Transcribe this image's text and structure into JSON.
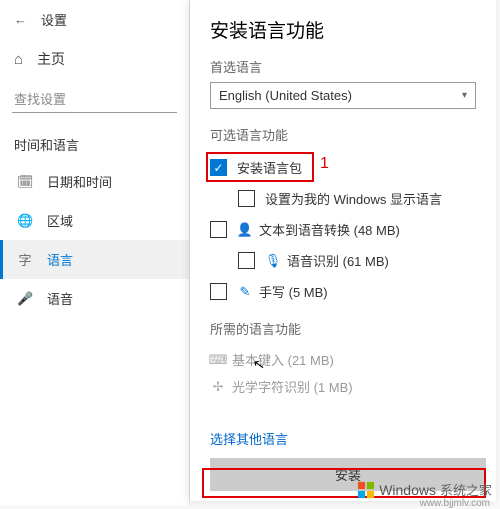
{
  "settings": {
    "title": "设置",
    "home": "主页",
    "search_placeholder": "查找设置",
    "section": "时间和语言",
    "nav": [
      {
        "icon": "calendar",
        "label": "日期和时间"
      },
      {
        "icon": "globe",
        "label": "区域"
      },
      {
        "icon": "lang",
        "label": "语言"
      },
      {
        "icon": "mic",
        "label": "语音"
      }
    ]
  },
  "panel": {
    "title": "安装语言功能",
    "preferred_label": "首选语言",
    "dropdown_value": "English (United States)",
    "optional_section": "可选语言功能",
    "options": [
      {
        "checked": true,
        "icon": "",
        "label": "安装语言包",
        "indent": false
      },
      {
        "checked": false,
        "icon": "",
        "label": "设置为我的 Windows 显示语言",
        "indent": true
      },
      {
        "checked": false,
        "icon": "tts",
        "label": "文本到语音转换 (48 MB)",
        "indent": false
      },
      {
        "checked": false,
        "icon": "speech",
        "label": "语音识别 (61 MB)",
        "indent": true
      },
      {
        "checked": false,
        "icon": "pen",
        "label": "手写 (5 MB)",
        "indent": false
      }
    ],
    "required_section": "所需的语言功能",
    "required": [
      {
        "icon": "keyboard",
        "label": "基本键入 (21 MB)"
      },
      {
        "icon": "ocr",
        "label": "光学字符识别 (1 MB)"
      }
    ],
    "other_link": "选择其他语言",
    "install_btn": "安装"
  },
  "annotation": {
    "num1": "1"
  },
  "watermark": {
    "brand": "Windows",
    "cn": "系统之家",
    "url": "www.bjjmlv.com"
  }
}
